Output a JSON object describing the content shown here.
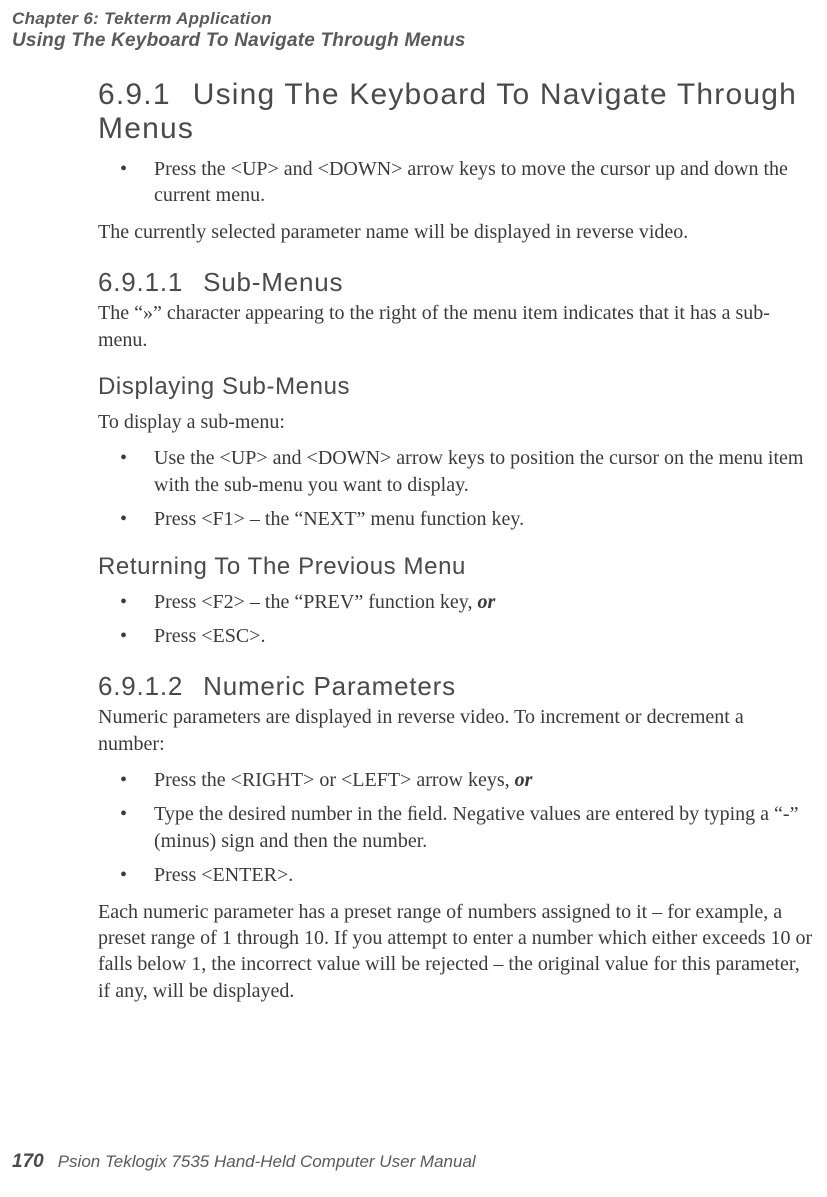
{
  "running_head": {
    "line1": "Chapter 6: Tekterm Application",
    "line2": "Using The Keyboard To Navigate Through Menus"
  },
  "sections": {
    "s691": {
      "num": "6.9.1",
      "title": "Using The Keyboard To Navigate Through Menus",
      "bullet1": "Press the <UP> and <DOWN> arrow keys to move the cursor up and down the current menu.",
      "para1": "The currently selected parameter name will be displayed in reverse video."
    },
    "s6911": {
      "num": "6.9.1.1",
      "title": "Sub-Menus",
      "para1": "The “»” character appearing to the right of the menu item indicates that it has a sub-menu."
    },
    "displaying": {
      "title": "Displaying Sub-Menus",
      "para1": "To display a sub-menu:",
      "bullet1": "Use the <UP> and <DOWN> arrow keys to position the cursor on the menu item with the sub-menu you want to display.",
      "bullet2": "Press <F1> – the “NEXT” menu function key."
    },
    "returning": {
      "title": "Returning To The Previous Menu",
      "bullet1_pre": "Press <F2> – the “PREV” function key, ",
      "bullet1_or": "or",
      "bullet2": "Press <ESC>."
    },
    "s6912": {
      "num": "6.9.1.2",
      "title": "Numeric Parameters",
      "para1": "Numeric parameters are displayed in reverse video. To increment or decrement a number:",
      "bullet1_pre": "Press the <RIGHT> or <LEFT> arrow keys, ",
      "bullet1_or": "or",
      "bullet2": "Type the desired number in the ﬁeld. Negative values are entered by typing a “-” (minus) sign and then the number.",
      "bullet3": "Press <ENTER>.",
      "para2": "Each numeric parameter has a preset range of numbers assigned to it – for example, a preset range of 1 through 10. If you attempt to enter a number which either exceeds 10 or falls below 1, the incorrect value will be rejected – the original value for this parameter, if any, will be displayed."
    }
  },
  "footer": {
    "page_number": "170",
    "text": "Psion Teklogix 7535 Hand-Held Computer User Manual"
  }
}
